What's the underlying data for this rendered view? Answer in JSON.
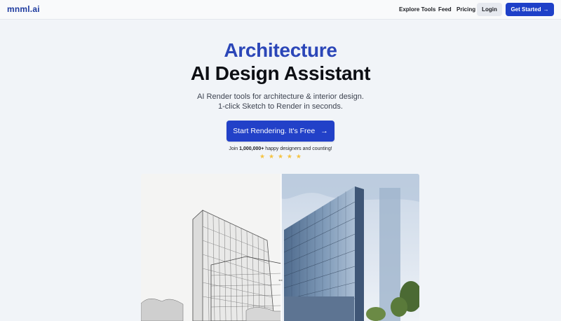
{
  "nav": {
    "logo": "mnml.ai",
    "links": [
      "Explore Tools",
      "Feed",
      "Pricing"
    ],
    "login": "Login",
    "get_started": "Get Started",
    "get_started_arrow": "→"
  },
  "hero": {
    "line1": "Architecture",
    "line2": "AI Design Assistant",
    "sub1": "AI Render tools for architecture & interior design.",
    "sub2": "1-click Sketch to Render in seconds.",
    "cta_label": "Start Rendering. It's Free",
    "cta_arrow": "→",
    "join_prefix": "Join ",
    "join_count": "1,000,000+",
    "join_suffix": " happy designers and counting!",
    "stars": [
      "★",
      "★",
      "★",
      "★",
      "★"
    ],
    "rating": 5
  },
  "comparison": {
    "handle_glyph": "⇔"
  },
  "colors": {
    "accent": "#2241c8",
    "heading_accent": "#2b46b8",
    "star": "#f5c342",
    "background": "#f1f4f8"
  }
}
